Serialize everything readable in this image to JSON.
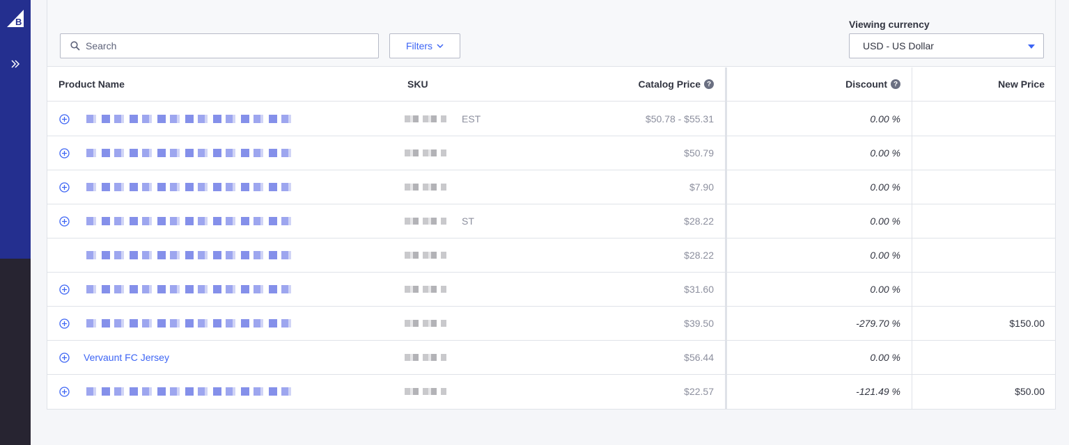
{
  "nav": {
    "logo_icon": "bigcommerce-logo",
    "expand_icon": "double-chevron-right-icon"
  },
  "toolbar": {
    "search_placeholder": "Search",
    "filters_label": "Filters",
    "currency_label": "Viewing currency",
    "currency_value": "USD - US Dollar"
  },
  "table": {
    "columns": {
      "product_name": "Product Name",
      "sku": "SKU",
      "catalog_price": "Catalog Price",
      "discount": "Discount",
      "new_price": "New Price"
    },
    "rows": [
      {
        "name": "",
        "sku_tail": "EST",
        "catalog_price": "$50.78 - $55.31",
        "discount": "0.00 %",
        "new_price": "",
        "expandable": true
      },
      {
        "name": "",
        "sku_tail": "",
        "catalog_price": "$50.79",
        "discount": "0.00 %",
        "new_price": "",
        "expandable": true
      },
      {
        "name": "",
        "sku_tail": "",
        "catalog_price": "$7.90",
        "discount": "0.00 %",
        "new_price": "",
        "expandable": true
      },
      {
        "name": "",
        "sku_tail": "ST",
        "catalog_price": "$28.22",
        "discount": "0.00 %",
        "new_price": "",
        "expandable": true
      },
      {
        "name": "",
        "sku_tail": "",
        "catalog_price": "$28.22",
        "discount": "0.00 %",
        "new_price": "",
        "expandable": false
      },
      {
        "name": "",
        "sku_tail": "",
        "catalog_price": "$31.60",
        "discount": "0.00 %",
        "new_price": "",
        "expandable": true
      },
      {
        "name": "",
        "sku_tail": "",
        "catalog_price": "$39.50",
        "discount": "-279.70 %",
        "new_price": "$150.00",
        "expandable": true
      },
      {
        "name": "Vervaunt FC Jersey",
        "sku_tail": "",
        "catalog_price": "$56.44",
        "discount": "0.00 %",
        "new_price": "",
        "expandable": true
      },
      {
        "name": "",
        "sku_tail": "",
        "catalog_price": "$22.57",
        "discount": "-121.49 %",
        "new_price": "$50.00",
        "expandable": true
      }
    ]
  },
  "colors": {
    "rail_top": "#242f8f",
    "rail_bottom": "#272431",
    "accent": "#3c64f4"
  }
}
